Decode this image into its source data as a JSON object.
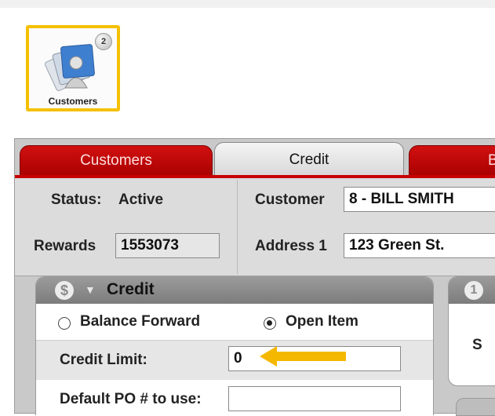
{
  "app_icon": {
    "label": "Customers",
    "badge_count": "2",
    "icon": "customers-icon"
  },
  "tabs": [
    {
      "label": "Customers",
      "active": false
    },
    {
      "label": "Credit",
      "active": true
    },
    {
      "label": "Ba",
      "active": false
    }
  ],
  "info": {
    "status_label": "Status:",
    "status_value": "Active",
    "rewards_label": "Rewards",
    "rewards_value": "1553073",
    "customer_label": "Customer",
    "customer_value": "8 - BILL  SMITH",
    "address1_label": "Address 1",
    "address1_value": "123 Green St."
  },
  "credit": {
    "icon": "dollar-icon",
    "icon_text": "$",
    "collapse_icon": "triangle-down-icon",
    "title": "Credit",
    "options": [
      {
        "label": "Balance Forward",
        "selected": false
      },
      {
        "label": "Open Item",
        "selected": true
      }
    ],
    "credit_limit_label": "Credit Limit:",
    "credit_limit_value": "0",
    "default_po_label": "Default PO # to use:",
    "default_po_value": ""
  },
  "side_section": {
    "icon_text": "1",
    "label": "S"
  },
  "colors": {
    "accent_red": "#c80000",
    "highlight_yellow": "#f5c000"
  }
}
